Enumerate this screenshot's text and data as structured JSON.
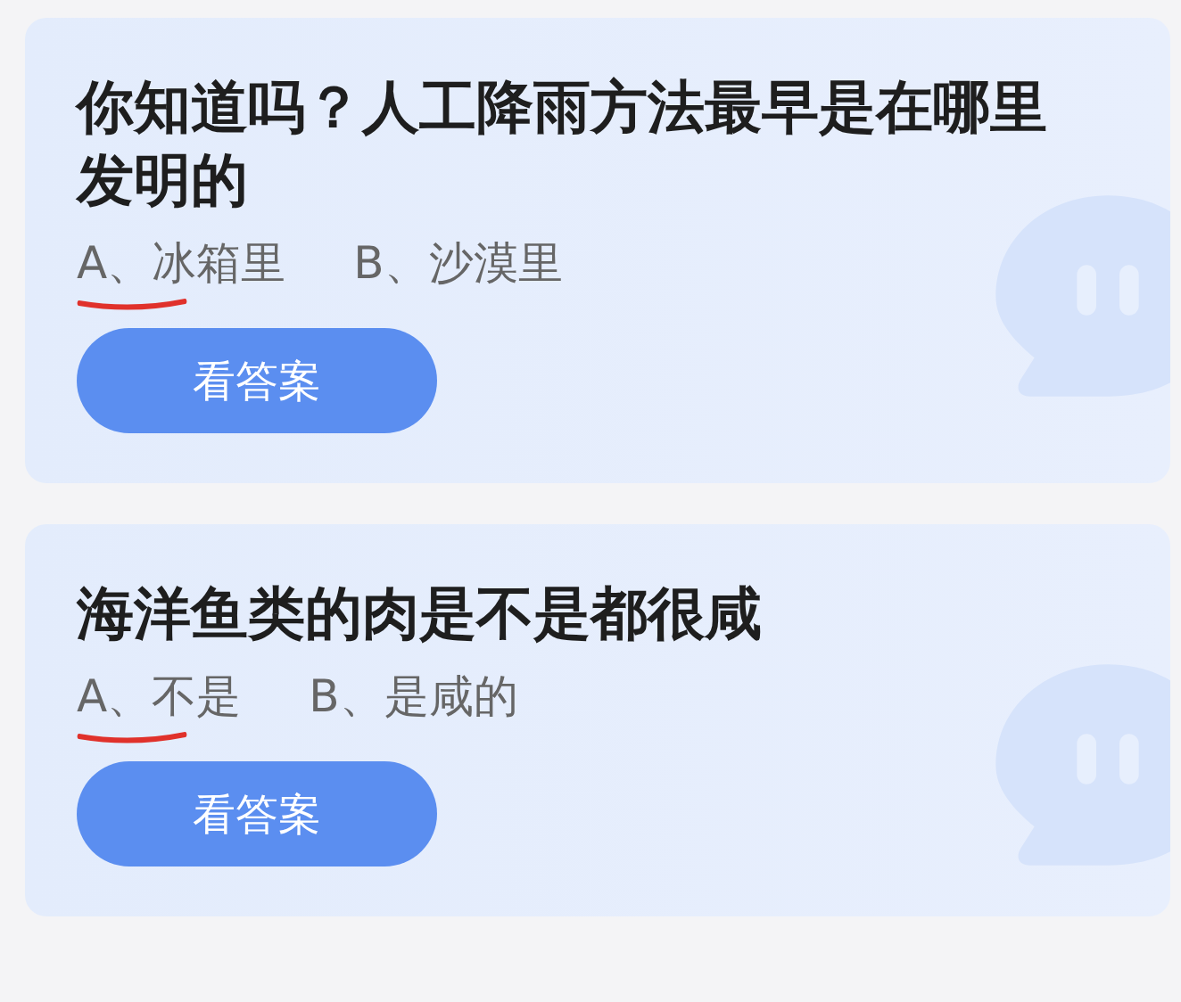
{
  "cards": [
    {
      "question": "你知道吗？人工降雨方法最早是在哪里发明的",
      "options": [
        {
          "text": "A、冰箱里",
          "underlined": true
        },
        {
          "text": "B、沙漠里",
          "underlined": false
        }
      ],
      "button": "看答案"
    },
    {
      "question": "海洋鱼类的肉是不是都很咸",
      "options": [
        {
          "text": "A、不是",
          "underlined": true
        },
        {
          "text": "B、是咸的",
          "underlined": false
        }
      ],
      "button": "看答案"
    }
  ]
}
